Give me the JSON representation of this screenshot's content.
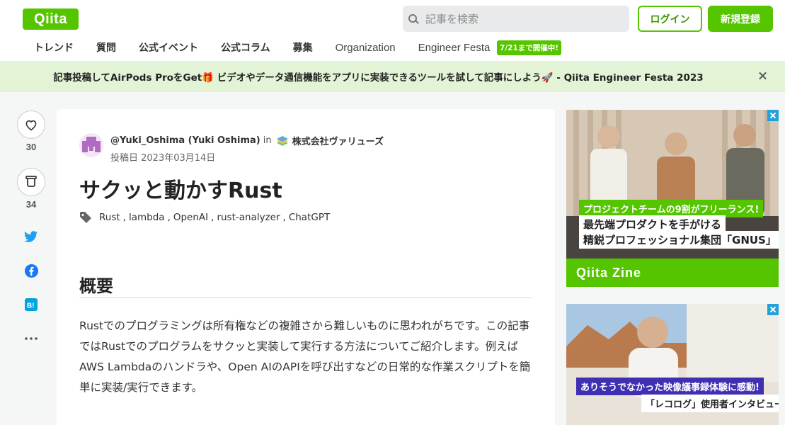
{
  "header": {
    "logo": "Qiita",
    "search_placeholder": "記事を検索",
    "login_label": "ログイン",
    "signup_label": "新規登録",
    "nav": [
      "トレンド",
      "質問",
      "公式イベント",
      "公式コラム",
      "募集",
      "Organization",
      "Engineer Festa"
    ],
    "nav_badge": "7/21まで開催中!"
  },
  "banner": {
    "text": "記事投稿してAirPods ProをGet🎁 ビデオやデータ通信機能をアプリに実装できるツールを試して記事にしよう🚀 - Qiita Engineer Festa 2023"
  },
  "actions": {
    "likes": "30",
    "stocks": "34"
  },
  "article": {
    "author_id": "@Yuki_Oshima (Yuki Oshima)",
    "in_label": "in",
    "org": "株式会社ヴァリューズ",
    "date": "投稿日 2023年03月14日",
    "title": "サクッと動かすRust",
    "tags": [
      "Rust",
      "lambda",
      "OpenAI",
      "rust-analyzer",
      "ChatGPT"
    ],
    "heading": "概要",
    "body": "Rustでのプログラミングは所有権などの複雑さから難しいものに思われがちです。この記事ではRustでのプログラムをサクッと実装して実行する方法についてご紹介します。例えばAWS Lambdaのハンドラや、Open AIのAPIを呼び出すなどの日常的な作業スクリプトを簡単に実装/実行できます。"
  },
  "ads": {
    "ad1_line1": "プロジェクトチームの9割がフリーランス!",
    "ad1_line2": "最先端プロダクトを手がける",
    "ad1_line3": "精鋭プロフェッショナル集団「GNUS」",
    "ad1_brand": "Qiita Zine",
    "ad2_line1": "ありそうでなかった映像議事録体験に感動!",
    "ad2_line2": "「レコログ」使用者インタビュー"
  }
}
